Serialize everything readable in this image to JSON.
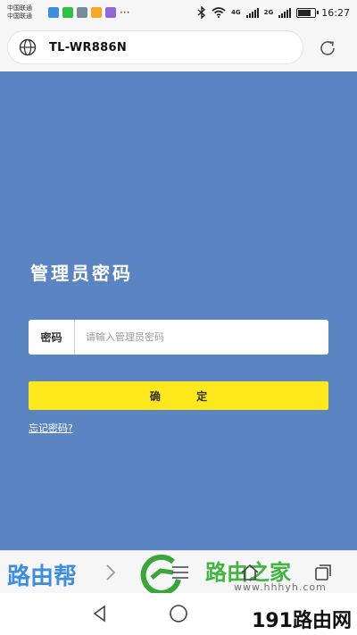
{
  "status_bar": {
    "carrier_1": "中国联通",
    "carrier_2": "中国联通",
    "more": "···",
    "network_1": "4G",
    "network_2": "2G",
    "time": "16:27",
    "battery_level": 0.7,
    "notification_icons": [
      "app-icon-blue",
      "wechat-icon",
      "image-icon",
      "app-icon-orange",
      "app-icon-purple"
    ]
  },
  "address_bar": {
    "url": "TL-WR886N",
    "icons": [
      "globe-icon",
      "refresh-icon"
    ]
  },
  "login": {
    "title": "管理员密码",
    "password_label": "密码",
    "password_placeholder": "请输入管理员密码",
    "password_value": "",
    "confirm_label": "确 定",
    "forgot_link": "忘记密码?"
  },
  "browser_toolbar": {
    "icons": [
      "forward-icon",
      "menu-icon",
      "home-icon",
      "tabs-icon"
    ]
  },
  "watermarks": {
    "left": "路由帮",
    "middle": "路由之家",
    "middle_url": "www.hhhyh.com",
    "right": "191路由网"
  },
  "nav_bar": {
    "icons": [
      "back-icon",
      "home-circle-icon",
      "recent-apps-icon"
    ]
  },
  "colors": {
    "page_background": "#5b84c2",
    "confirm_button": "#fde81b",
    "watermark_blue": "#3f8ede",
    "watermark_green": "#40b540"
  }
}
